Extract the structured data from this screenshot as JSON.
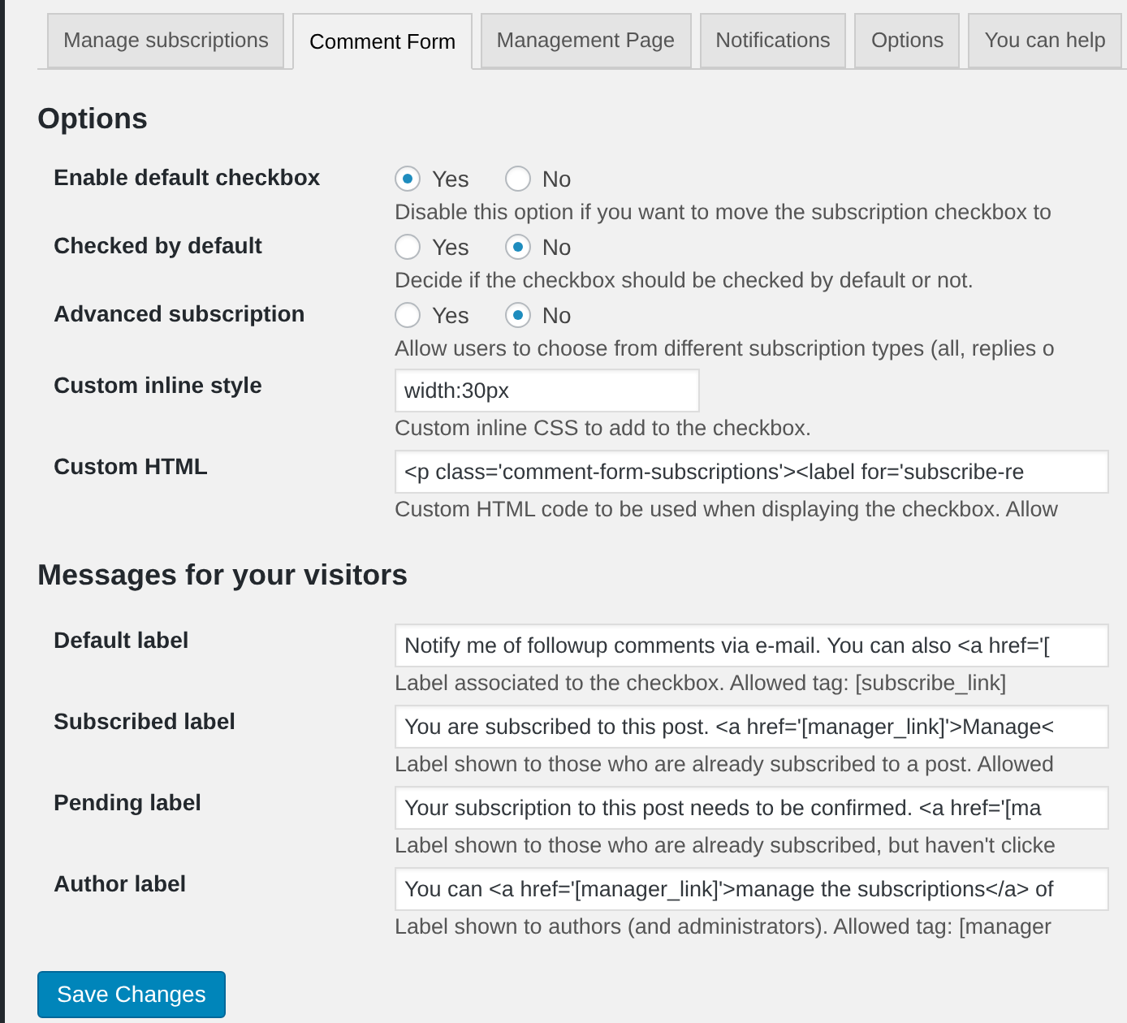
{
  "tabs": [
    {
      "label": "Manage subscriptions",
      "selected": false
    },
    {
      "label": "Comment Form",
      "selected": true
    },
    {
      "label": "Management Page",
      "selected": false
    },
    {
      "label": "Notifications",
      "selected": false
    },
    {
      "label": "Options",
      "selected": false
    },
    {
      "label": "You can help",
      "selected": false
    }
  ],
  "sections": [
    {
      "title": "Options",
      "rows": [
        {
          "kind": "radio",
          "label": "Enable default checkbox",
          "options": [
            {
              "label": "Yes",
              "selected": true
            },
            {
              "label": "No",
              "selected": false
            }
          ],
          "description": "Disable this option if you want to move the subscription checkbox to"
        },
        {
          "kind": "radio",
          "label": "Checked by default",
          "options": [
            {
              "label": "Yes",
              "selected": false
            },
            {
              "label": "No",
              "selected": true
            }
          ],
          "description": "Decide if the checkbox should be checked by default or not."
        },
        {
          "kind": "radio",
          "label": "Advanced subscription",
          "options": [
            {
              "label": "Yes",
              "selected": false
            },
            {
              "label": "No",
              "selected": true
            }
          ],
          "description": "Allow users to choose from different subscription types (all, replies o"
        },
        {
          "kind": "short_text",
          "label": "Custom inline style",
          "value": "width:30px",
          "description": "Custom inline CSS to add to the checkbox."
        },
        {
          "kind": "text",
          "label": "Custom HTML",
          "value": "<p class='comment-form-subscriptions'><label for='subscribe-re",
          "description": "Custom HTML code to be used when displaying the checkbox. Allow"
        }
      ]
    },
    {
      "title": "Messages for your visitors",
      "rows": [
        {
          "kind": "text",
          "label": "Default label",
          "value": "Notify me of followup comments via e-mail. You can also <a href='[",
          "description": "Label associated to the checkbox. Allowed tag: [subscribe_link]"
        },
        {
          "kind": "text",
          "label": "Subscribed label",
          "value": "You are subscribed to this post. <a href='[manager_link]'>Manage<",
          "description": "Label shown to those who are already subscribed to a post. Allowed"
        },
        {
          "kind": "text",
          "label": "Pending label",
          "value": "Your subscription to this post needs to be confirmed. <a href='[ma",
          "description": "Label shown to those who are already subscribed, but haven't clicke"
        },
        {
          "kind": "text",
          "label": "Author label",
          "value": "You can <a href='[manager_link]'>manage the subscriptions</a> of",
          "description": "Label shown to authors (and administrators). Allowed tag: [manager"
        }
      ]
    }
  ],
  "save_button": "Save Changes"
}
